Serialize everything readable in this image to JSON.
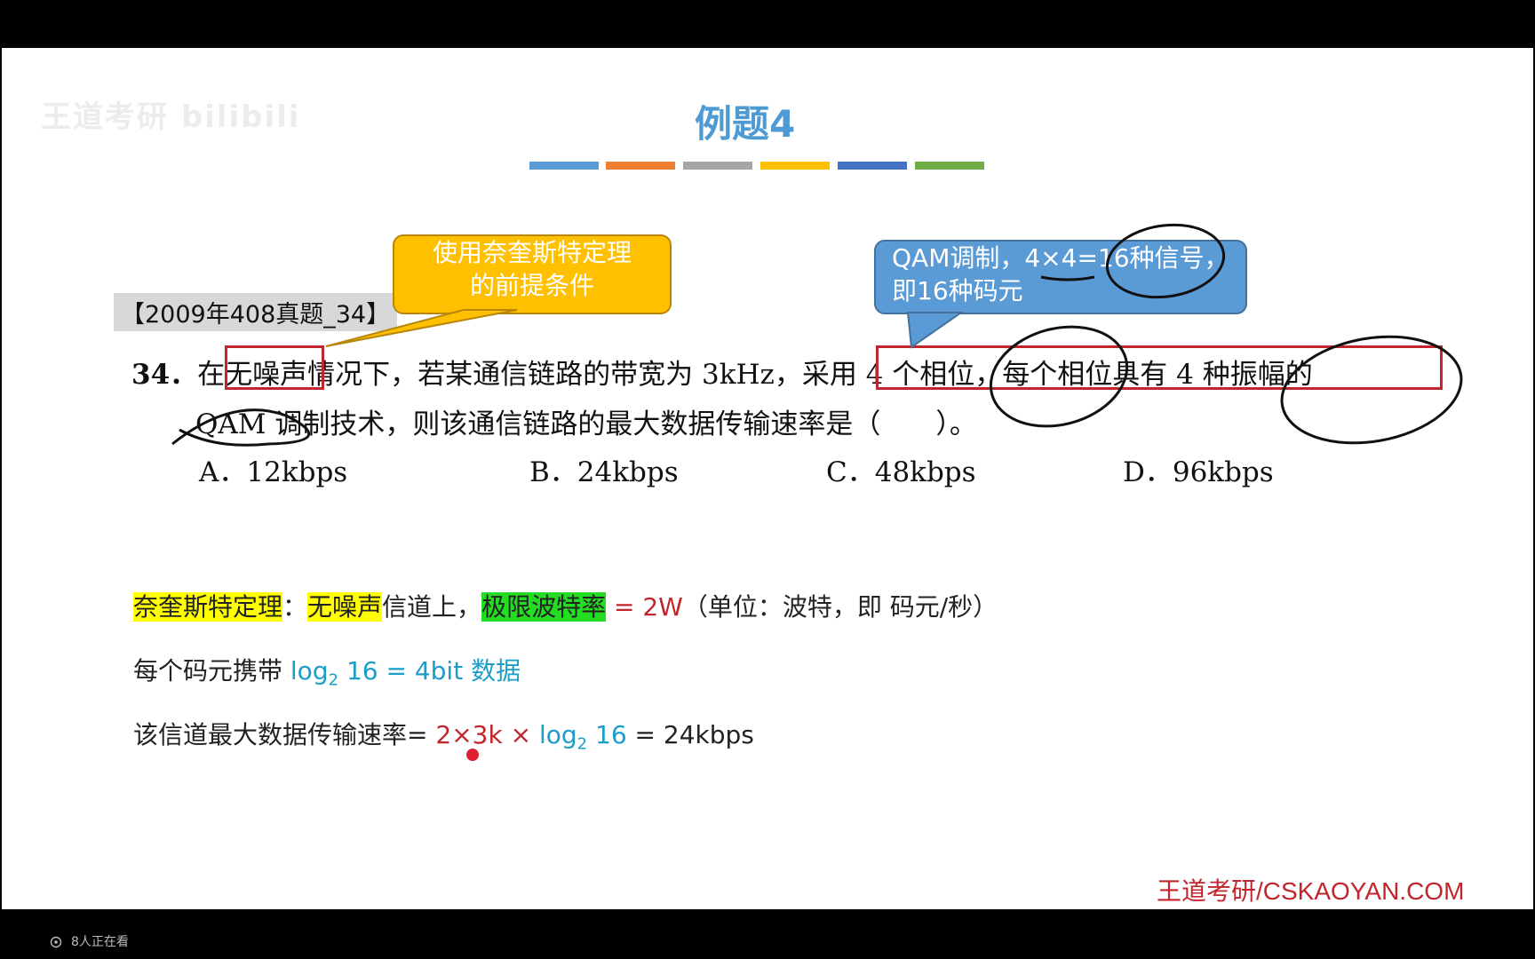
{
  "slide": {
    "logo_text": "王道考研 bilibili",
    "title": "例题4",
    "color_bars": [
      "#5b9bd5",
      "#ed7d31",
      "#a5a5a5",
      "#ffc000",
      "#4472c4",
      "#70ad47"
    ],
    "source_label": "【2009年408真题_34】",
    "callout_left": {
      "line1": "使用奈奎斯特定理",
      "line2": "的前提条件"
    },
    "callout_right": {
      "line1": "QAM调制，4×4=16种信号，",
      "line2": "即16种码元"
    },
    "question": {
      "number": "34．",
      "line1_a": "在",
      "line1_b": "无噪声",
      "line1_c": "情况下，若某通信链路的带宽为 3kHz，",
      "line1_d": "采用 4 个相位，每个相位具有 4 种振幅",
      "line1_e": "的",
      "line2": "QAM 调制技术，则该通信链路的最大数据传输速率是（　　）。",
      "options": [
        "A．12kbps",
        "B．24kbps",
        "C．48kbps",
        "D．96kbps"
      ]
    },
    "solution": {
      "line1": {
        "t1": "奈奎斯特定理",
        "t2": "：",
        "t3": "无噪声",
        "t4": "信道上，",
        "t5": "极限波特率",
        "t6": " = 2W",
        "t7": "（单位：波特，即 码元/秒）"
      },
      "line2": {
        "t1": "每个码元携带 ",
        "t2": "log",
        "t3": "2",
        "t4": " 16 = 4bit 数据"
      },
      "line3": {
        "t1": "该信道最大数据传输速率",
        "t2": "= ",
        "t3": "2×3k × ",
        "t4": "log",
        "t5": "2",
        "t6": " 16",
        "t7": " = 24kbps"
      }
    },
    "footer": "王道考研/CSKAOYAN.COM"
  },
  "viewer": {
    "count_text": "8人正在看"
  }
}
